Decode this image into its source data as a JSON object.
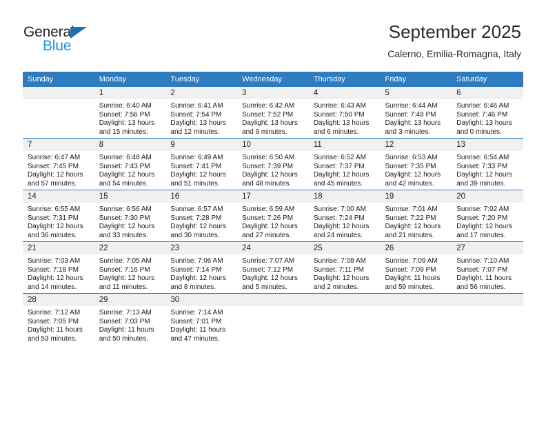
{
  "brand": {
    "name_part1": "General",
    "name_part2": "Blue",
    "accent_color": "#1f8fe0",
    "triangle_color": "#1f6fb4"
  },
  "header": {
    "title": "September 2025",
    "subtitle": "Calerno, Emilia-Romagna, Italy"
  },
  "theme": {
    "header_row_bg": "#2d7cc0",
    "daynum_strip_bg": "#f0f0f0",
    "cell_border": "#2d7cc0"
  },
  "weekday_headers": [
    "Sunday",
    "Monday",
    "Tuesday",
    "Wednesday",
    "Thursday",
    "Friday",
    "Saturday"
  ],
  "weeks": [
    [
      {
        "day": "",
        "empty": true,
        "sunrise": "",
        "sunset": "",
        "daylight_line1": "",
        "daylight_line2": ""
      },
      {
        "day": "1",
        "empty": false,
        "sunrise": "Sunrise: 6:40 AM",
        "sunset": "Sunset: 7:56 PM",
        "daylight_line1": "Daylight: 13 hours",
        "daylight_line2": "and 15 minutes."
      },
      {
        "day": "2",
        "empty": false,
        "sunrise": "Sunrise: 6:41 AM",
        "sunset": "Sunset: 7:54 PM",
        "daylight_line1": "Daylight: 13 hours",
        "daylight_line2": "and 12 minutes."
      },
      {
        "day": "3",
        "empty": false,
        "sunrise": "Sunrise: 6:42 AM",
        "sunset": "Sunset: 7:52 PM",
        "daylight_line1": "Daylight: 13 hours",
        "daylight_line2": "and 9 minutes."
      },
      {
        "day": "4",
        "empty": false,
        "sunrise": "Sunrise: 6:43 AM",
        "sunset": "Sunset: 7:50 PM",
        "daylight_line1": "Daylight: 13 hours",
        "daylight_line2": "and 6 minutes."
      },
      {
        "day": "5",
        "empty": false,
        "sunrise": "Sunrise: 6:44 AM",
        "sunset": "Sunset: 7:48 PM",
        "daylight_line1": "Daylight: 13 hours",
        "daylight_line2": "and 3 minutes."
      },
      {
        "day": "6",
        "empty": false,
        "sunrise": "Sunrise: 6:46 AM",
        "sunset": "Sunset: 7:46 PM",
        "daylight_line1": "Daylight: 13 hours",
        "daylight_line2": "and 0 minutes."
      }
    ],
    [
      {
        "day": "7",
        "empty": false,
        "sunrise": "Sunrise: 6:47 AM",
        "sunset": "Sunset: 7:45 PM",
        "daylight_line1": "Daylight: 12 hours",
        "daylight_line2": "and 57 minutes."
      },
      {
        "day": "8",
        "empty": false,
        "sunrise": "Sunrise: 6:48 AM",
        "sunset": "Sunset: 7:43 PM",
        "daylight_line1": "Daylight: 12 hours",
        "daylight_line2": "and 54 minutes."
      },
      {
        "day": "9",
        "empty": false,
        "sunrise": "Sunrise: 6:49 AM",
        "sunset": "Sunset: 7:41 PM",
        "daylight_line1": "Daylight: 12 hours",
        "daylight_line2": "and 51 minutes."
      },
      {
        "day": "10",
        "empty": false,
        "sunrise": "Sunrise: 6:50 AM",
        "sunset": "Sunset: 7:39 PM",
        "daylight_line1": "Daylight: 12 hours",
        "daylight_line2": "and 48 minutes."
      },
      {
        "day": "11",
        "empty": false,
        "sunrise": "Sunrise: 6:52 AM",
        "sunset": "Sunset: 7:37 PM",
        "daylight_line1": "Daylight: 12 hours",
        "daylight_line2": "and 45 minutes."
      },
      {
        "day": "12",
        "empty": false,
        "sunrise": "Sunrise: 6:53 AM",
        "sunset": "Sunset: 7:35 PM",
        "daylight_line1": "Daylight: 12 hours",
        "daylight_line2": "and 42 minutes."
      },
      {
        "day": "13",
        "empty": false,
        "sunrise": "Sunrise: 6:54 AM",
        "sunset": "Sunset: 7:33 PM",
        "daylight_line1": "Daylight: 12 hours",
        "daylight_line2": "and 39 minutes."
      }
    ],
    [
      {
        "day": "14",
        "empty": false,
        "sunrise": "Sunrise: 6:55 AM",
        "sunset": "Sunset: 7:31 PM",
        "daylight_line1": "Daylight: 12 hours",
        "daylight_line2": "and 36 minutes."
      },
      {
        "day": "15",
        "empty": false,
        "sunrise": "Sunrise: 6:56 AM",
        "sunset": "Sunset: 7:30 PM",
        "daylight_line1": "Daylight: 12 hours",
        "daylight_line2": "and 33 minutes."
      },
      {
        "day": "16",
        "empty": false,
        "sunrise": "Sunrise: 6:57 AM",
        "sunset": "Sunset: 7:28 PM",
        "daylight_line1": "Daylight: 12 hours",
        "daylight_line2": "and 30 minutes."
      },
      {
        "day": "17",
        "empty": false,
        "sunrise": "Sunrise: 6:59 AM",
        "sunset": "Sunset: 7:26 PM",
        "daylight_line1": "Daylight: 12 hours",
        "daylight_line2": "and 27 minutes."
      },
      {
        "day": "18",
        "empty": false,
        "sunrise": "Sunrise: 7:00 AM",
        "sunset": "Sunset: 7:24 PM",
        "daylight_line1": "Daylight: 12 hours",
        "daylight_line2": "and 24 minutes."
      },
      {
        "day": "19",
        "empty": false,
        "sunrise": "Sunrise: 7:01 AM",
        "sunset": "Sunset: 7:22 PM",
        "daylight_line1": "Daylight: 12 hours",
        "daylight_line2": "and 21 minutes."
      },
      {
        "day": "20",
        "empty": false,
        "sunrise": "Sunrise: 7:02 AM",
        "sunset": "Sunset: 7:20 PM",
        "daylight_line1": "Daylight: 12 hours",
        "daylight_line2": "and 17 minutes."
      }
    ],
    [
      {
        "day": "21",
        "empty": false,
        "sunrise": "Sunrise: 7:03 AM",
        "sunset": "Sunset: 7:18 PM",
        "daylight_line1": "Daylight: 12 hours",
        "daylight_line2": "and 14 minutes."
      },
      {
        "day": "22",
        "empty": false,
        "sunrise": "Sunrise: 7:05 AM",
        "sunset": "Sunset: 7:16 PM",
        "daylight_line1": "Daylight: 12 hours",
        "daylight_line2": "and 11 minutes."
      },
      {
        "day": "23",
        "empty": false,
        "sunrise": "Sunrise: 7:06 AM",
        "sunset": "Sunset: 7:14 PM",
        "daylight_line1": "Daylight: 12 hours",
        "daylight_line2": "and 8 minutes."
      },
      {
        "day": "24",
        "empty": false,
        "sunrise": "Sunrise: 7:07 AM",
        "sunset": "Sunset: 7:12 PM",
        "daylight_line1": "Daylight: 12 hours",
        "daylight_line2": "and 5 minutes."
      },
      {
        "day": "25",
        "empty": false,
        "sunrise": "Sunrise: 7:08 AM",
        "sunset": "Sunset: 7:11 PM",
        "daylight_line1": "Daylight: 12 hours",
        "daylight_line2": "and 2 minutes."
      },
      {
        "day": "26",
        "empty": false,
        "sunrise": "Sunrise: 7:09 AM",
        "sunset": "Sunset: 7:09 PM",
        "daylight_line1": "Daylight: 11 hours",
        "daylight_line2": "and 59 minutes."
      },
      {
        "day": "27",
        "empty": false,
        "sunrise": "Sunrise: 7:10 AM",
        "sunset": "Sunset: 7:07 PM",
        "daylight_line1": "Daylight: 11 hours",
        "daylight_line2": "and 56 minutes."
      }
    ],
    [
      {
        "day": "28",
        "empty": false,
        "sunrise": "Sunrise: 7:12 AM",
        "sunset": "Sunset: 7:05 PM",
        "daylight_line1": "Daylight: 11 hours",
        "daylight_line2": "and 53 minutes."
      },
      {
        "day": "29",
        "empty": false,
        "sunrise": "Sunrise: 7:13 AM",
        "sunset": "Sunset: 7:03 PM",
        "daylight_line1": "Daylight: 11 hours",
        "daylight_line2": "and 50 minutes."
      },
      {
        "day": "30",
        "empty": false,
        "sunrise": "Sunrise: 7:14 AM",
        "sunset": "Sunset: 7:01 PM",
        "daylight_line1": "Daylight: 11 hours",
        "daylight_line2": "and 47 minutes."
      },
      {
        "day": "",
        "empty": true,
        "sunrise": "",
        "sunset": "",
        "daylight_line1": "",
        "daylight_line2": ""
      },
      {
        "day": "",
        "empty": true,
        "sunrise": "",
        "sunset": "",
        "daylight_line1": "",
        "daylight_line2": ""
      },
      {
        "day": "",
        "empty": true,
        "sunrise": "",
        "sunset": "",
        "daylight_line1": "",
        "daylight_line2": ""
      },
      {
        "day": "",
        "empty": true,
        "sunrise": "",
        "sunset": "",
        "daylight_line1": "",
        "daylight_line2": ""
      }
    ]
  ]
}
